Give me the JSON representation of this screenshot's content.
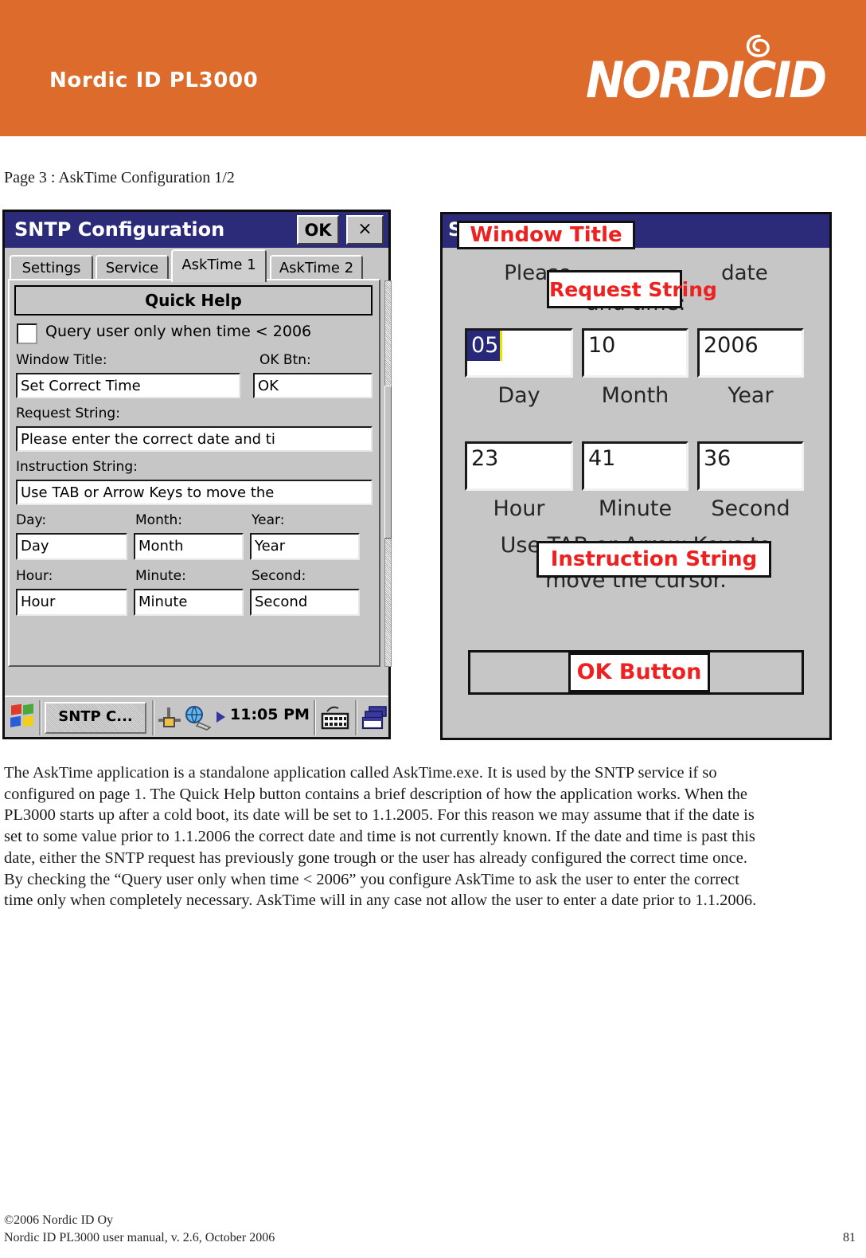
{
  "header": {
    "product_title": "Nordic ID PL3000",
    "logo_text": "NORDICID",
    "logo_icon": "swirl-icon",
    "background_color": "#dd6b2c"
  },
  "page_caption": "Page 3 : AskTime Configuration 1/2",
  "sntp_window": {
    "title": "SNTP Configuration",
    "ok_button": "OK",
    "close_button": "×",
    "tabs": [
      {
        "label": "Settings",
        "active": false
      },
      {
        "label": "Service",
        "active": false
      },
      {
        "label": "AskTime 1",
        "active": true
      },
      {
        "label": "AskTime 2",
        "active": false
      }
    ],
    "quick_help_button": "Quick Help",
    "query_checkbox": {
      "label": "Query user only when time < 2006",
      "checked": false
    },
    "fields": {
      "window_title": {
        "label": "Window Title:",
        "value": "Set Correct Time"
      },
      "ok_btn": {
        "label": "OK Btn:",
        "value": "OK"
      },
      "request_string": {
        "label": "Request String:",
        "value": "Please enter the correct date and ti"
      },
      "instruction_string": {
        "label": "Instruction String:",
        "value": "Use TAB or Arrow Keys to move the"
      },
      "day": {
        "label": "Day:",
        "value": "Day"
      },
      "month": {
        "label": "Month:",
        "value": "Month"
      },
      "year": {
        "label": "Year:",
        "value": "Year"
      },
      "hour": {
        "label": "Hour:",
        "value": "Hour"
      },
      "minute": {
        "label": "Minute:",
        "value": "Minute"
      },
      "second": {
        "label": "Second:",
        "value": "Second"
      }
    },
    "taskbar": {
      "start_icon": "windows-flag-icon",
      "task_button": "SNTP C...",
      "tray_icons": [
        "connection-icon",
        "globe-network-icon",
        "play-arrow-icon"
      ],
      "clock": "11:05 PM",
      "keyboard_icon": "keyboard-icon",
      "desktop_icon": "show-desktop-icon"
    }
  },
  "asktime_window": {
    "title_underlying": "Set Correct Time",
    "title_callout": "Window Title",
    "request_text_before": "Please",
    "request_text_after": "date",
    "request_text_line2": "and time:",
    "request_callout": "Request String",
    "date_fields": [
      {
        "value": "05",
        "caption": "Day",
        "selected": true
      },
      {
        "value": "10",
        "caption": "Month",
        "selected": false
      },
      {
        "value": "2006",
        "caption": "Year",
        "selected": false
      }
    ],
    "time_fields": [
      {
        "value": "23",
        "caption": "Hour",
        "selected": false
      },
      {
        "value": "41",
        "caption": "Minute",
        "selected": false
      },
      {
        "value": "36",
        "caption": "Second",
        "selected": false
      }
    ],
    "instruction_line1": "Use TAB or Arrow Keys to",
    "instruction_line2": "move the cursor.",
    "instruction_callout": "Instruction String",
    "ok_button_callout": "OK Button",
    "callout_color": "#ee2020"
  },
  "body_paragraph": "The AskTime application is a standalone application called AskTime.exe. It is used by the SNTP service if so configured on page 1. The Quick Help button contains a brief description of how the application works. When the PL3000 starts up after a cold boot, its date will be set to 1.1.2005. For this reason we may assume that if the date is set to some value prior to 1.1.2006 the correct date and time is not currently known. If the date and time is past this date, either the SNTP request has previously gone trough or the user has already configured the correct time once. By checking the “Query user only when time < 2006” you configure AskTime to ask the user to enter the correct time only when completely necessary. AskTime will in any case not allow the user to enter a date prior to 1.1.2006.",
  "footer": {
    "line1": "©2006 Nordic ID Oy",
    "line2": "Nordic ID PL3000 user manual, v. 2.6, October 2006",
    "page_number": "81"
  }
}
